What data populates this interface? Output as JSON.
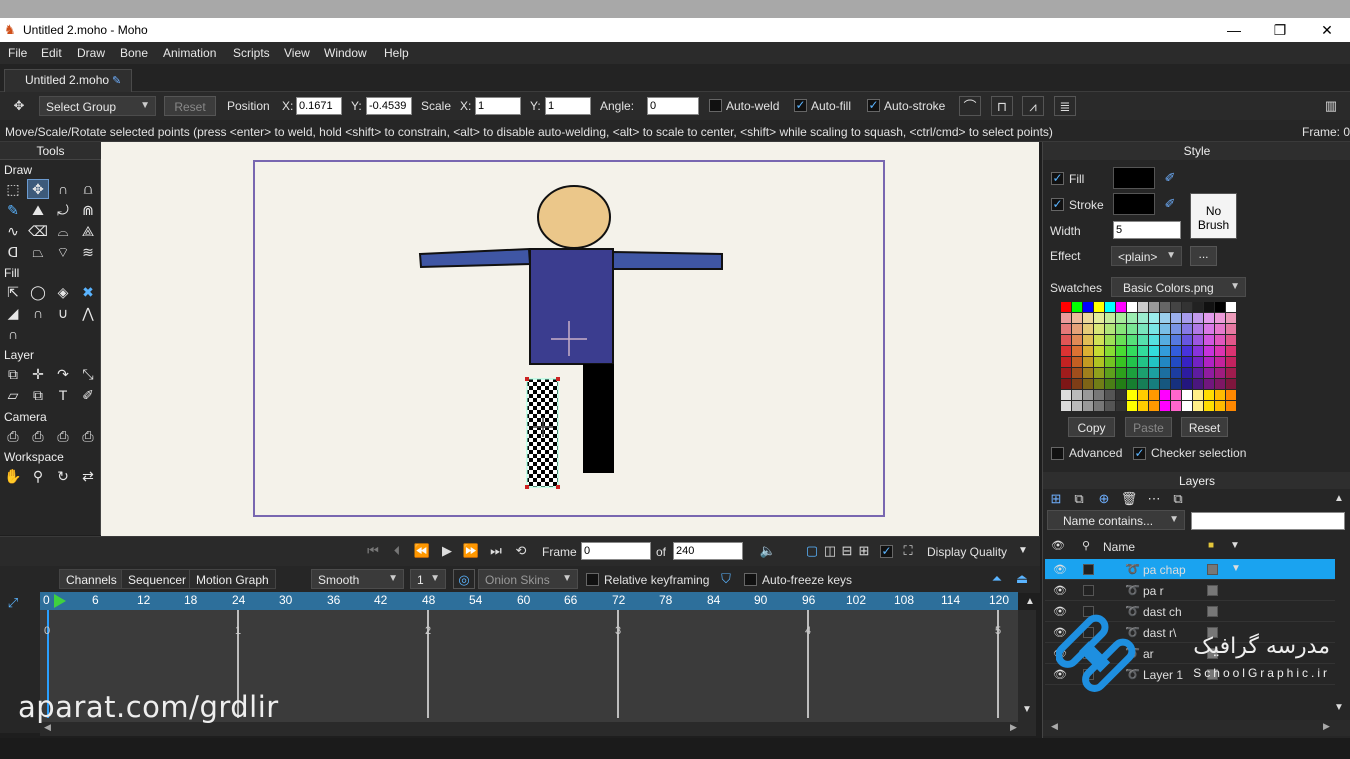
{
  "window": {
    "title": "Untitled 2.moho - Moho",
    "minimize": "—",
    "restore": "❐",
    "close": "✕"
  },
  "menu": [
    "File",
    "Edit",
    "Draw",
    "Bone",
    "Animation",
    "Scripts",
    "View",
    "Window",
    "Help"
  ],
  "doc_tab": {
    "label": "Untitled 2.moho"
  },
  "tool_options": {
    "select_group": "Select Group",
    "reset": "Reset",
    "position_label": "Position",
    "x_label": "X:",
    "x_value": "0.1671",
    "y_label": "Y:",
    "y_value": "-0.4539",
    "scale_label": "Scale",
    "sx_label": "X:",
    "sx_value": "1",
    "sy_label": "Y:",
    "sy_value": "1",
    "angle_label": "Angle:",
    "angle_value": "0",
    "auto_weld": "Auto-weld",
    "auto_weld_checked": false,
    "auto_fill": "Auto-fill",
    "auto_fill_checked": true,
    "auto_stroke": "Auto-stroke",
    "auto_stroke_checked": true
  },
  "hint": "Move/Scale/Rotate selected points (press <enter> to weld, hold <shift> to constrain, <alt> to disable auto-welding, <alt> to scale to center, <shift> while scaling to squash, <ctrl/cmd> to select points)",
  "frame_status": "Frame: 0",
  "tools": {
    "header": "Tools",
    "draw": "Draw",
    "fill": "Fill",
    "layer": "Layer",
    "camera": "Camera",
    "workspace": "Workspace"
  },
  "timeline_controls": {
    "frame_label": "Frame",
    "frame_value": "0",
    "of_label": "of",
    "total_frames": "240",
    "display_quality": "Display Quality"
  },
  "timeline": {
    "tabs": [
      "Channels",
      "Sequencer",
      "Motion Graph"
    ],
    "interp": "Smooth",
    "step": "1",
    "onion": "Onion Skins",
    "relative_keyframing": "Relative keyframing",
    "auto_freeze": "Auto-freeze keys",
    "ruler": [
      "0",
      "6",
      "12",
      "18",
      "24",
      "30",
      "36",
      "42",
      "48",
      "54",
      "60",
      "66",
      "72",
      "78",
      "84",
      "90",
      "96",
      "102",
      "108",
      "114",
      "120"
    ],
    "seconds": [
      "0",
      "1",
      "2",
      "3",
      "4",
      "5"
    ]
  },
  "style": {
    "header": "Style",
    "fill": "Fill",
    "stroke": "Stroke",
    "width": "Width",
    "width_value": "5",
    "effect": "Effect",
    "effect_value": "<plain>",
    "effect_more": "...",
    "no_brush": "No Brush",
    "swatches": "Swatches",
    "swatch_file": "Basic Colors.png",
    "copy": "Copy",
    "paste": "Paste",
    "reset": "Reset",
    "advanced": "Advanced",
    "checker_selection": "Checker selection",
    "fill_color": "#000000",
    "stroke_color": "#000000"
  },
  "layers": {
    "header": "Layers",
    "filter": "Name contains...",
    "name_col": "Name",
    "items": [
      {
        "name": "pa chap",
        "selected": true
      },
      {
        "name": "pa r",
        "selected": false
      },
      {
        "name": "dast ch",
        "selected": false
      },
      {
        "name": "dast r\\",
        "selected": false
      },
      {
        "name": "ar",
        "selected": false
      },
      {
        "name": "Layer 1",
        "selected": false
      }
    ]
  },
  "watermark": "aparat.com/grdlir",
  "brand": {
    "fa": "مدرسه گرافیک",
    "en": "SchoolGraphic.ir"
  },
  "colors": {
    "accent": "#1aa3f0",
    "ruler": "#2d6f9b",
    "stage_border": "#7867b0",
    "head": "#ebc78a",
    "body": "#3b3d8f",
    "arm": "#3f56a4"
  }
}
